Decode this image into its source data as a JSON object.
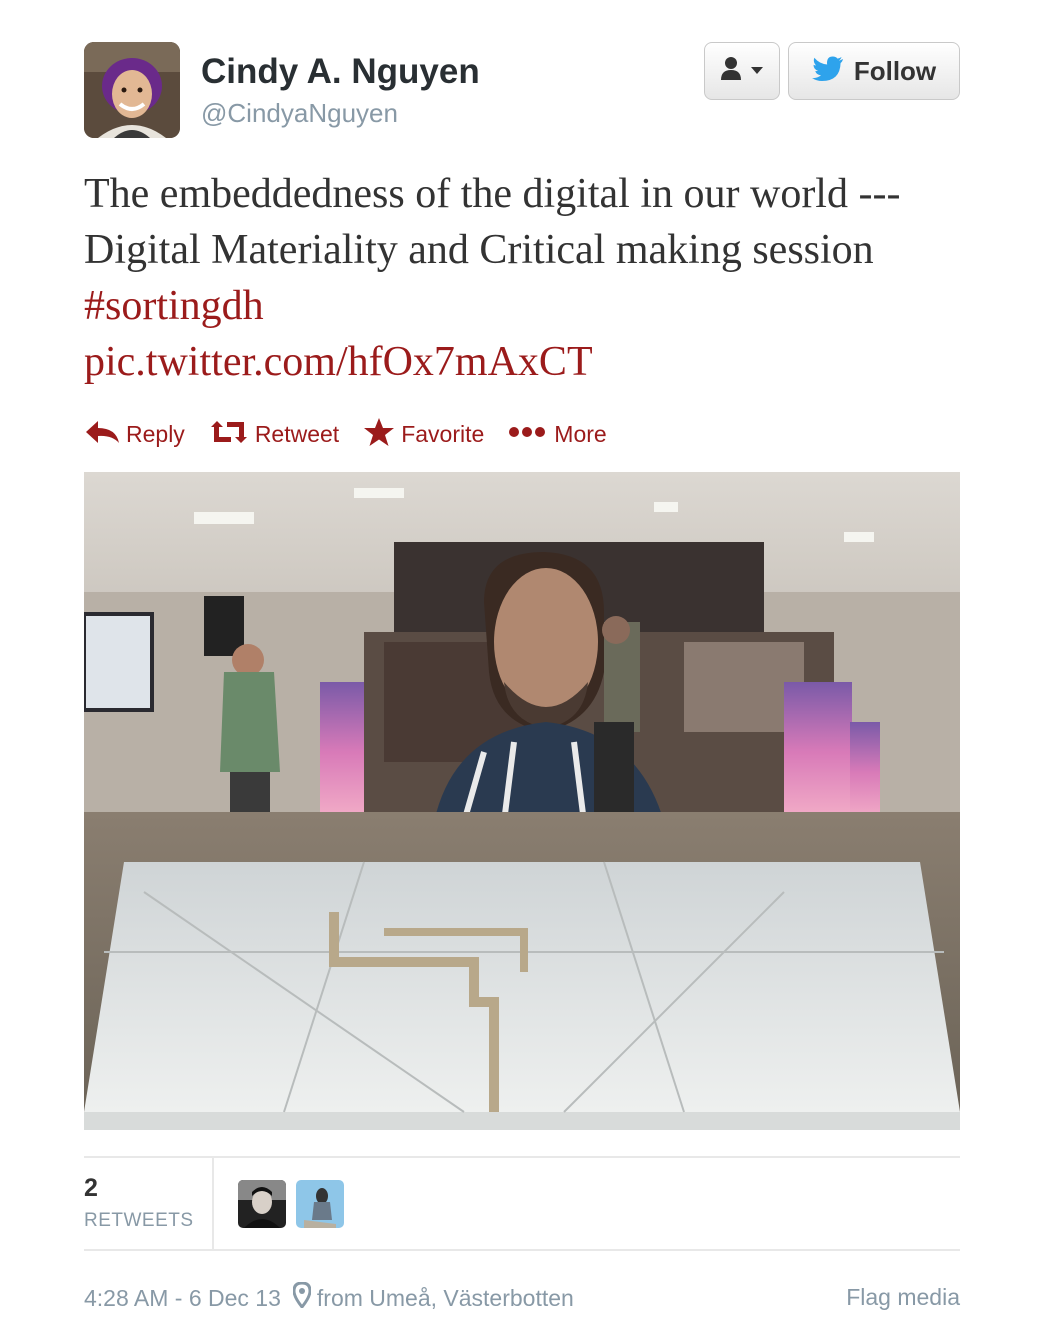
{
  "user": {
    "name": "Cindy A. Nguyen",
    "handle": "@CindyaNguyen"
  },
  "buttons": {
    "follow_label": "Follow"
  },
  "tweet": {
    "text_before": "The embeddedness of the digital in our world ---Digital Materiality and Critical making session ",
    "hashtag": "#sortingdh",
    "pic_link": "pic.twitter.com/hfOx7mAxCT"
  },
  "actions": [
    {
      "label": "Reply",
      "icon": "reply-icon"
    },
    {
      "label": "Retweet",
      "icon": "retweet-icon"
    },
    {
      "label": "Favorite",
      "icon": "star-icon"
    },
    {
      "label": "More",
      "icon": "more-dots-icon"
    }
  ],
  "stats": {
    "retweets_count": "2",
    "retweets_label": "RETWEETS"
  },
  "footer": {
    "timestamp": "4:28 AM - 6 Dec 13",
    "location": "from Umeå, Västerbotten",
    "flag_media": "Flag media"
  },
  "colors": {
    "link": "#9b1b1b",
    "twitter_blue": "#2ea3ec",
    "muted": "#8899a6"
  }
}
